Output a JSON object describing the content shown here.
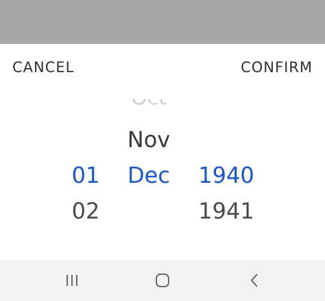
{
  "dialog": {
    "cancel_label": "CANCEL",
    "confirm_label": "CONFIRM"
  },
  "picker": {
    "day": {
      "above": "",
      "selected": "01",
      "below": "02"
    },
    "month": {
      "faded": "Oct",
      "above": "Nov",
      "selected": "Dec",
      "below": ""
    },
    "year": {
      "above": "",
      "selected": "1940",
      "below": "1941"
    }
  },
  "nav_bar": {
    "icons": [
      "recent-apps-icon",
      "home-icon",
      "back-icon"
    ]
  },
  "colors": {
    "selected": "#1a56c5",
    "dim_overlay": "#a6a6a6",
    "nav_bar_bg": "#f2f2f4"
  }
}
